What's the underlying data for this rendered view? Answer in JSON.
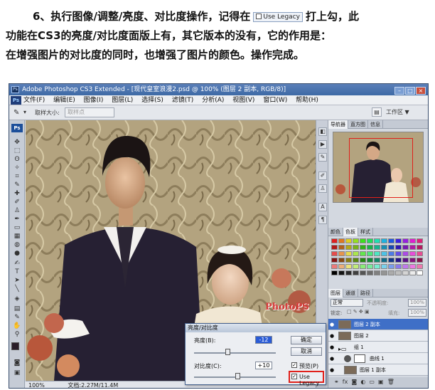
{
  "intro": {
    "line1_pre": "6、执行图像/调整/亮度、对比度操作，记得在",
    "legacy_chip": "Use Legacy",
    "line1_post": "打上勾，此",
    "line2": "功能在CS3的亮度/对比度面版上有，其它版本的没有，它的作用是：",
    "line3": "在增强图片的对比度的同时，也增强了图片的颜色。操作完成。"
  },
  "window": {
    "title": "Adobe Photoshop CS3 Extended - [现代皇室浪漫2.psd @ 100% (图层 2 副本, RGB/8)]",
    "app_badge": "Ps"
  },
  "menu": [
    "文件(F)",
    "编辑(E)",
    "图像(I)",
    "图层(L)",
    "选择(S)",
    "滤镜(T)",
    "分析(A)",
    "视图(V)",
    "窗口(W)",
    "帮助(H)"
  ],
  "options": {
    "sample_label": "取样大小:",
    "sample_value": "取样点",
    "workspace": "工作区 ▼"
  },
  "status": {
    "zoom": "100%",
    "doc": "文档:2.27M/11.4M"
  },
  "watermark": "PhotoPS",
  "panels": {
    "nav_tabs": [
      "导航器",
      "直方图",
      "信息"
    ],
    "color_tabs": [
      "颜色",
      "色板",
      "样式"
    ],
    "layer_tabs": [
      "图层",
      "通道",
      "路径"
    ],
    "blend_mode": "正常",
    "opacity_label": "不透明度:",
    "opacity_value": "100%",
    "lock_label": "锁定:",
    "fill_label": "填充:",
    "fill_value": "100%",
    "layers": [
      {
        "name": "图层 2 副本",
        "selected": true
      },
      {
        "name": "图层 2",
        "selected": false
      },
      {
        "name": "组 1",
        "selected": false
      },
      {
        "name": "曲线 1",
        "selected": false
      },
      {
        "name": "图层 1 副本",
        "selected": false
      }
    ]
  },
  "dialog": {
    "title": "亮度/对比度",
    "brightness_label": "亮度(B):",
    "brightness_value": "-12",
    "contrast_label": "对比度(C):",
    "contrast_value": "+10",
    "ok": "确定",
    "cancel": "取消",
    "preview": "预览(P)",
    "legacy": "Use Legacy"
  },
  "colors": {
    "highlight_red": "#e0201a",
    "title_blue": "#3e6aa5"
  }
}
